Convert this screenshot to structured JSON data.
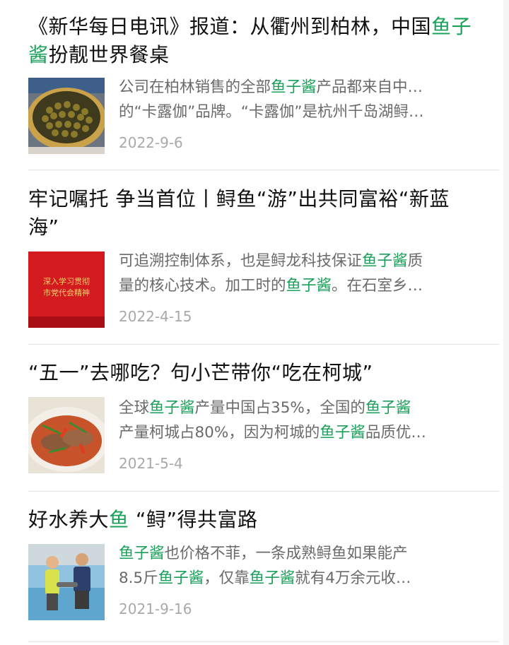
{
  "highlight_color": "#1aa05a",
  "articles": [
    {
      "title_a": "《新华每日电讯》报道：从衢州到柏林，中国",
      "title_hl1": "鱼子",
      "title_hl2": "酱",
      "title_b": "扮靓世界餐桌",
      "s1a": "公司在柏林销售的全部",
      "s1h": "鱼子酱",
      "s1b": "产品都来自中…",
      "s2": "的“卡露伽”品牌。“卡露伽”是杭州千岛湖鲟…",
      "date": "2022-9-6",
      "thumb_icon": "caviar-tin-image"
    },
    {
      "title_a": "牢记嘱托 争当首位丨鲟鱼“游”出共同富裕“新蓝",
      "title_b": "海”",
      "s1a": "可追溯控制体系，也是鲟龙科技保证",
      "s1h": "鱼子酱",
      "s1b": "质",
      "s2a": "量的核心技术。加工时的",
      "s2h": "鱼子酱",
      "s2b": "。在石室乡…",
      "date": "2022-4-15",
      "thumb_text1": "深入学习贯彻",
      "thumb_text2": "市党代会精神"
    },
    {
      "title": "“五一”去哪吃？句小芒带你“吃在柯城”",
      "s1a": "全球",
      "s1h1": "鱼子酱",
      "s1b": "产量中国占35%，全国的",
      "s1h2": "鱼子酱",
      "s2a": "产量柯城占80%，因为柯城的",
      "s2h": "鱼子酱",
      "s2b": "品质优…",
      "date": "2021-5-4",
      "thumb_icon": "fish-dish-image"
    },
    {
      "title_a": "好水养大",
      "title_hl": "鱼",
      "title_b": " “鲟”得共富路",
      "s1h": "鱼子酱",
      "s1b": "也价格不菲，一条成熟鲟鱼如果能产",
      "s2a": "8.5斤",
      "s2h1": "鱼子酱",
      "s2b": "，仅靠",
      "s2h2": "鱼子酱",
      "s2c": "就有4万余元收…",
      "date": "2021-9-16",
      "thumb_icon": "fish-farmers-image"
    }
  ]
}
